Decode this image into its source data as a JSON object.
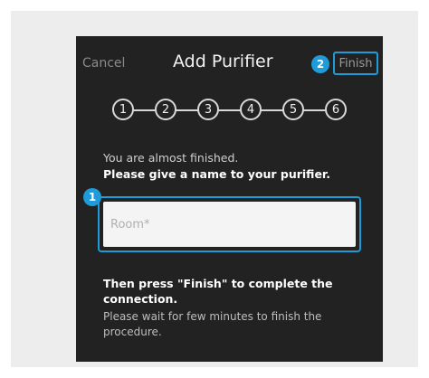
{
  "header": {
    "cancel_label": "Cancel",
    "title": "Add Purifier",
    "finish_label": "Finish"
  },
  "annotations": {
    "finish_badge": "2",
    "input_badge": "1"
  },
  "steps": [
    "1",
    "2",
    "3",
    "4",
    "5",
    "6"
  ],
  "body": {
    "intro": "You are almost finished.",
    "instruction": "Please give a name to your purifier.",
    "name_placeholder": "Room*",
    "finish_instruction": "Then press \"Finish\" to complete the connection.",
    "wait_note": "Please wait for few minutes to finish the procedure."
  },
  "colors": {
    "accent": "#1e9bd8",
    "screen_background": "#222222",
    "outer_background": "#ededed"
  }
}
